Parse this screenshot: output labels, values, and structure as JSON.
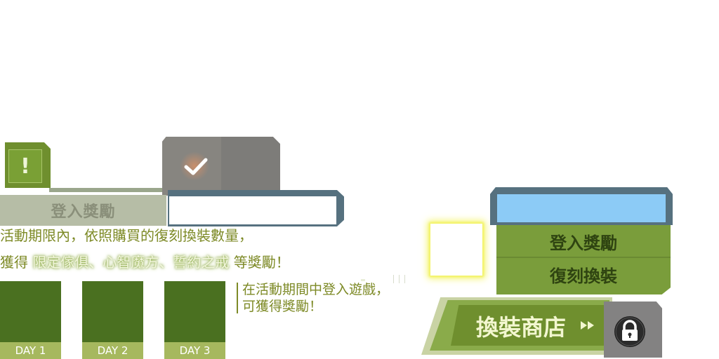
{
  "alert_icon": "!",
  "login_tab_label": "登入獎勵",
  "description": {
    "line1": "活動期限內，依照購買的復刻換裝數量，",
    "line2_prefix": "獲得",
    "line2_highlight": "限定傢俱、心智魔方、誓約之戒",
    "line2_suffix": "等獎勵！"
  },
  "days": [
    {
      "label": "DAY 1"
    },
    {
      "label": "DAY 2"
    },
    {
      "label": "DAY 3"
    }
  ],
  "note": {
    "line1": "在活動期間中登入遊戲，",
    "line2": "可獲得獎勵！"
  },
  "reward_panel": {
    "option_a": "登入獎勵",
    "option_b": "復刻換裝"
  },
  "shop_button": {
    "label": "換裝商店"
  },
  "icons": {
    "alert": "exclamation-icon",
    "check": "checkmark-icon",
    "arrow": "double-arrow-icon",
    "lock": "lock-icon"
  },
  "colors": {
    "green_dark": "#4a7020",
    "green": "#7a9d3b",
    "text_olive": "#7d8a26",
    "tab_blue": "#8ccbf6"
  }
}
